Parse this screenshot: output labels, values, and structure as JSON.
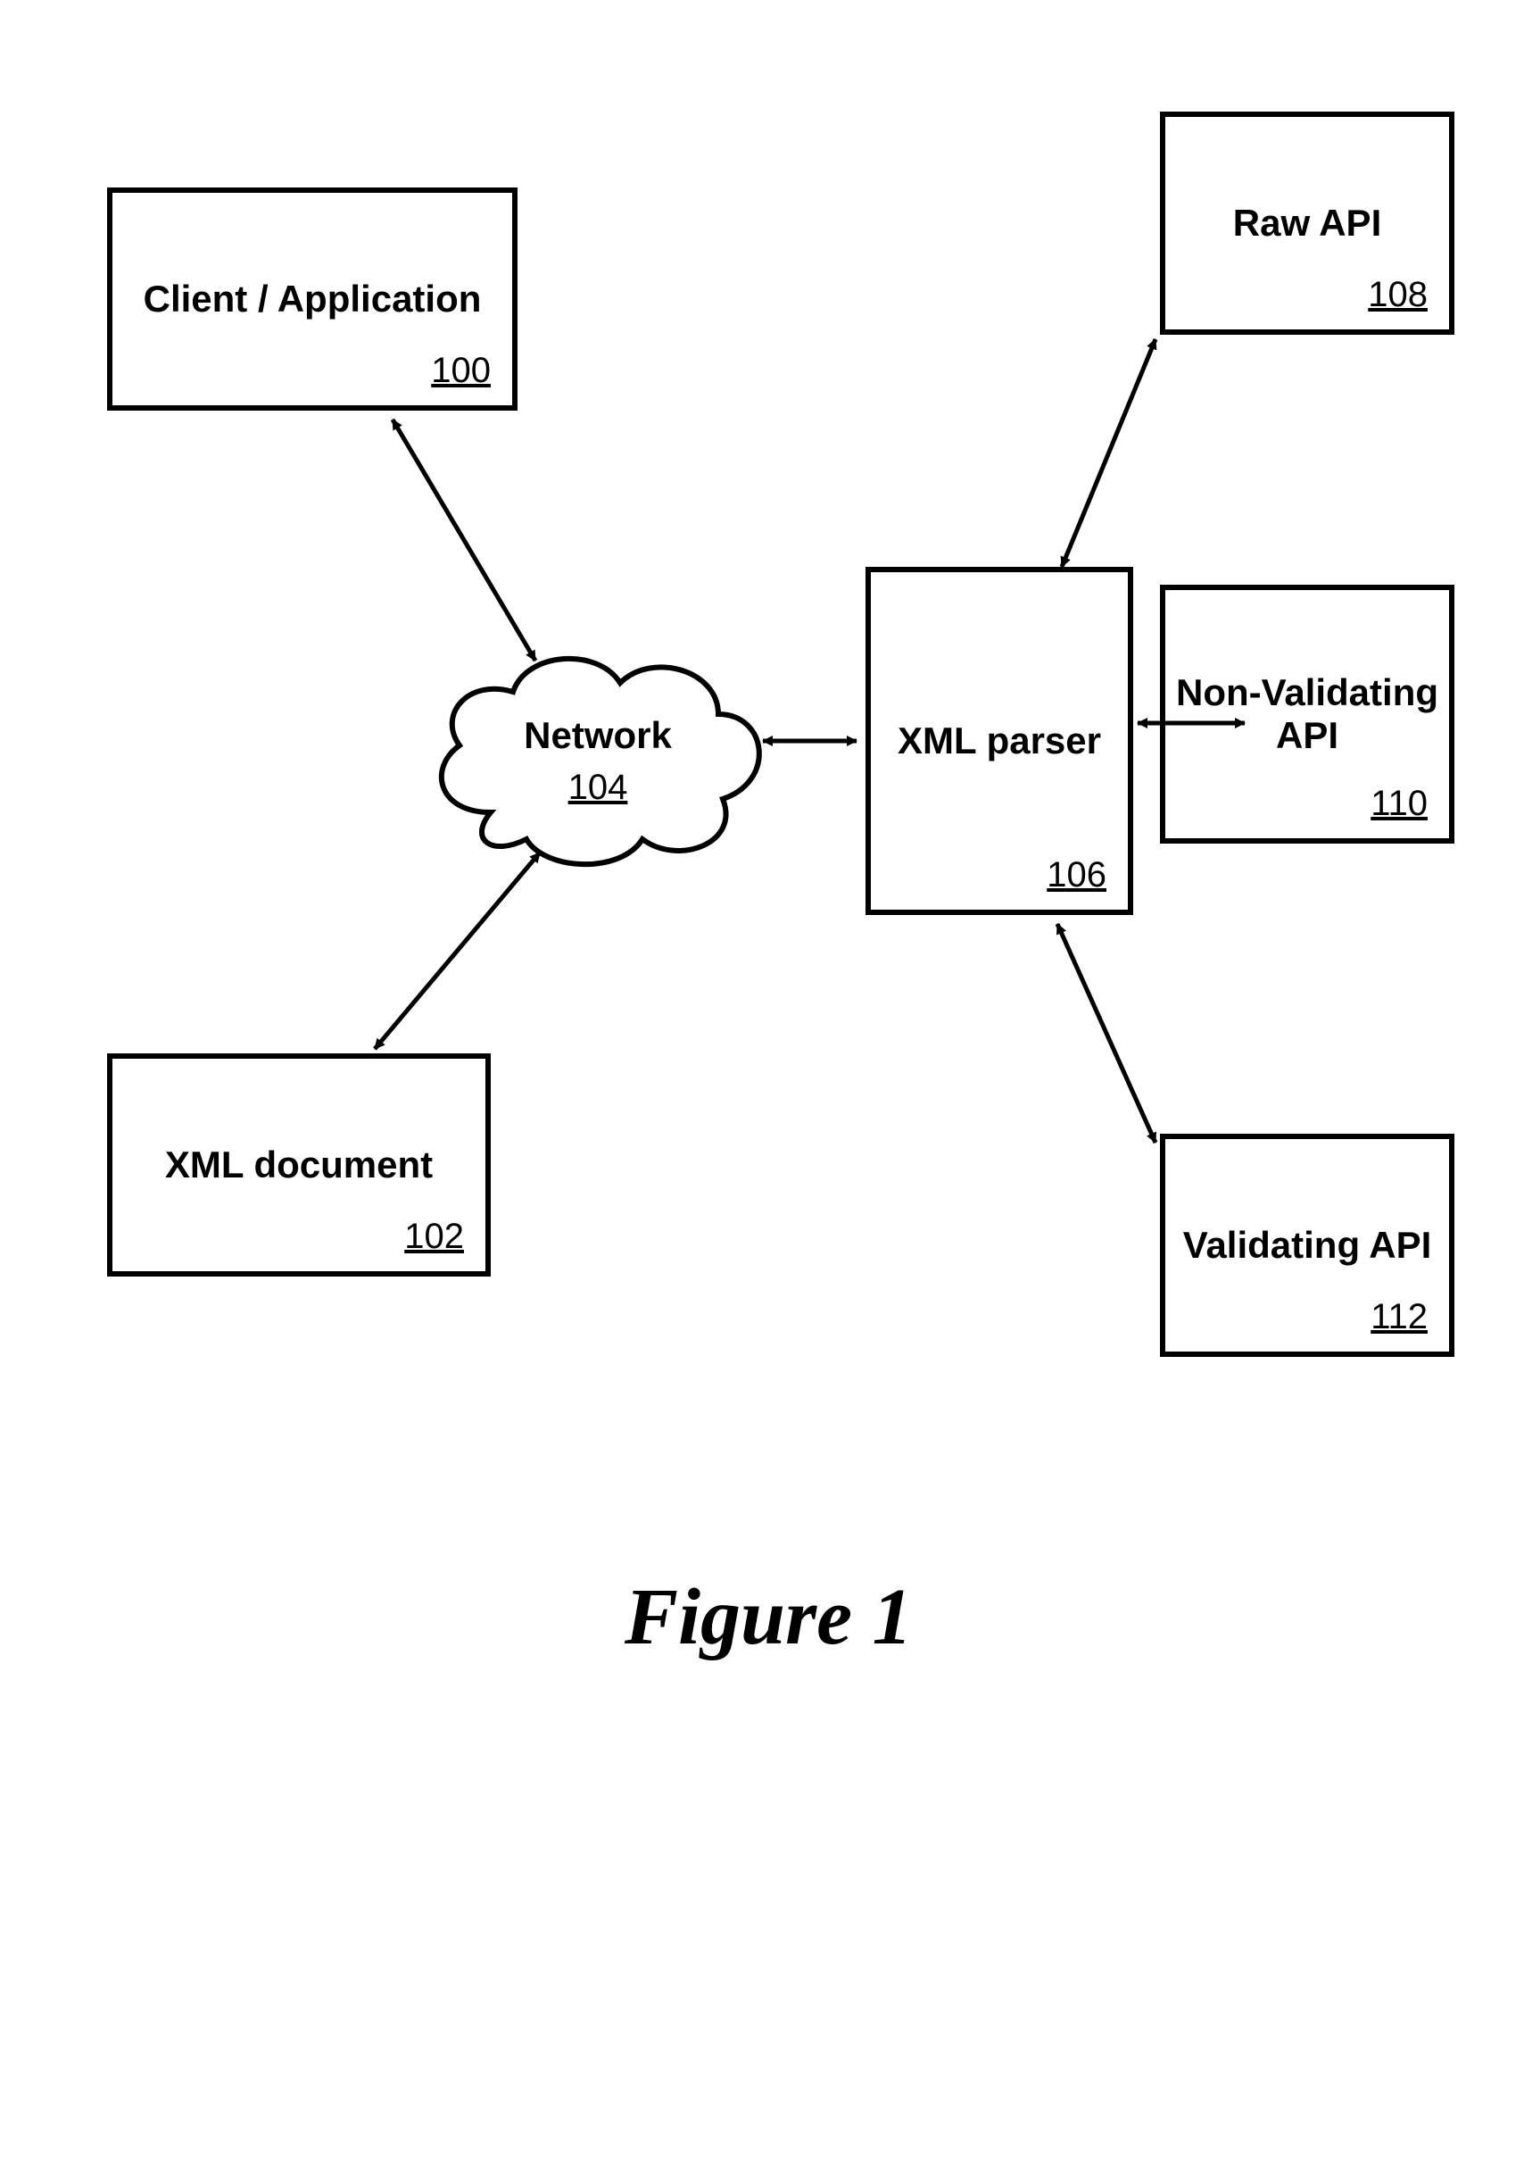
{
  "nodes": {
    "client": {
      "label": "Client / Application",
      "ref": "100"
    },
    "xmldoc": {
      "label": "XML document",
      "ref": "102"
    },
    "network": {
      "label": "Network",
      "ref": "104"
    },
    "parser": {
      "label": "XML parser",
      "ref": "106"
    },
    "raw": {
      "label": "Raw API",
      "ref": "108"
    },
    "nonval": {
      "label": "Non-Validating API",
      "ref": "110"
    },
    "val": {
      "label": "Validating API",
      "ref": "112"
    }
  },
  "caption": "Figure 1"
}
